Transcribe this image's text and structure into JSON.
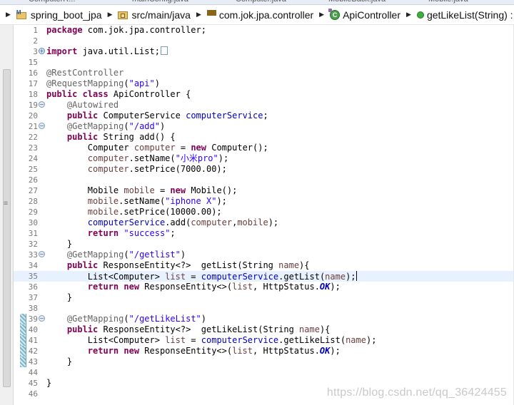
{
  "tabs": [
    "ComputerR...",
    "mainConfig.java",
    "Computer.java",
    "MobileBack.java",
    "Mobile.java"
  ],
  "breadcrumb": [
    {
      "label": "spring_boot_jpa",
      "icon": "maven-project-icon"
    },
    {
      "label": "src/main/java",
      "icon": "source-folder-icon"
    },
    {
      "label": "com.jok.jpa.controller",
      "icon": "package-icon"
    },
    {
      "label": "ApiController",
      "icon": "class-icon"
    },
    {
      "label": "getLikeList(String) : ResponseEntity<?>",
      "icon": "public-method-icon"
    }
  ],
  "editor": {
    "current_line": "35",
    "lines": [
      {
        "n": "1",
        "html": "<span class=\"kw\">package</span> com.jok.jpa.controller;"
      },
      {
        "n": "2",
        "html": ""
      },
      {
        "n": "3",
        "fold": "plus",
        "html": "<span class=\"kw\">import</span> java.util.List;<span class=\"collapsed-box\"></span>"
      },
      {
        "n": "15",
        "html": ""
      },
      {
        "n": "16",
        "html": "<span class=\"an\">@RestController</span>"
      },
      {
        "n": "17",
        "html": "<span class=\"an\">@RequestMapping</span>(<span class=\"str\">\"api\"</span>)"
      },
      {
        "n": "18",
        "html": "<span class=\"kw\">public class</span> ApiController {"
      },
      {
        "n": "19",
        "fold": "minus",
        "html": "    <span class=\"an\">@Autowired</span>"
      },
      {
        "n": "20",
        "html": "    <span class=\"kw\">public</span> ComputerService <span class=\"fld\">computerService</span>;"
      },
      {
        "n": "21",
        "fold": "minus",
        "html": "    <span class=\"an\">@GetMapping</span>(<span class=\"str\">\"/add\"</span>)"
      },
      {
        "n": "22",
        "html": "    <span class=\"kw\">public</span> String add() {"
      },
      {
        "n": "23",
        "html": "        Computer <span class=\"var\">computer</span> = <span class=\"kw\">new</span> Computer();"
      },
      {
        "n": "24",
        "html": "        <span class=\"var\">computer</span>.setName(<span class=\"str\">\"小米pro\"</span>);"
      },
      {
        "n": "25",
        "html": "        <span class=\"var\">computer</span>.setPrice(7000.00);"
      },
      {
        "n": "26",
        "html": ""
      },
      {
        "n": "27",
        "html": "        Mobile <span class=\"var\">mobile</span> = <span class=\"kw\">new</span> Mobile();"
      },
      {
        "n": "28",
        "html": "        <span class=\"var\">mobile</span>.setName(<span class=\"str\">\"iphone X\"</span>);"
      },
      {
        "n": "29",
        "html": "        <span class=\"var\">mobile</span>.setPrice(10000.00);"
      },
      {
        "n": "30",
        "html": "        <span class=\"fld\">computerService</span>.add(<span class=\"var\">computer</span>,<span class=\"var\">mobile</span>);"
      },
      {
        "n": "31",
        "html": "        <span class=\"kw\">return</span> <span class=\"str\">\"success\"</span>;"
      },
      {
        "n": "32",
        "html": "    }"
      },
      {
        "n": "33",
        "fold": "minus",
        "html": "    <span class=\"an\">@GetMapping</span>(<span class=\"str\">\"/getlist\"</span>)"
      },
      {
        "n": "34",
        "html": "    <span class=\"kw\">public</span> ResponseEntity&lt;?&gt;  getList(String <span class=\"var\">name</span>){"
      },
      {
        "n": "35",
        "html": "        List&lt;Computer&gt; <span class=\"var\">list</span> = <span class=\"fld\">computerService</span>.getList(<span class=\"var\">name</span>);<span class=\"caret\"></span>"
      },
      {
        "n": "36",
        "html": "        <span class=\"kw\">return new</span> ResponseEntity&lt;&gt;(<span class=\"var\">list</span>, HttpStatus.<span class=\"ital\">OK</span>);"
      },
      {
        "n": "37",
        "html": "    }"
      },
      {
        "n": "38",
        "html": ""
      },
      {
        "n": "39",
        "fold": "minus",
        "changed": true,
        "html": "    <span class=\"an\">@GetMapping</span>(<span class=\"str\">\"/getLikeList\"</span>)"
      },
      {
        "n": "40",
        "changed": true,
        "html": "    <span class=\"kw\">public</span> ResponseEntity&lt;?&gt;  getLikeList(String <span class=\"var\">name</span>){"
      },
      {
        "n": "41",
        "changed": true,
        "html": "        List&lt;Computer&gt; <span class=\"var\">list</span> = <span class=\"fld\">computerService</span>.getLikeList(<span class=\"var\">name</span>);"
      },
      {
        "n": "42",
        "changed": true,
        "html": "        <span class=\"kw\">return new</span> ResponseEntity&lt;&gt;(<span class=\"var\">list</span>, HttpStatus.<span class=\"ital\">OK</span>);"
      },
      {
        "n": "43",
        "changed": true,
        "html": "    }"
      },
      {
        "n": "44",
        "html": ""
      },
      {
        "n": "45",
        "html": "}"
      },
      {
        "n": "46",
        "html": ""
      }
    ]
  },
  "watermark": "https://blog.csdn.net/qq_36424455"
}
